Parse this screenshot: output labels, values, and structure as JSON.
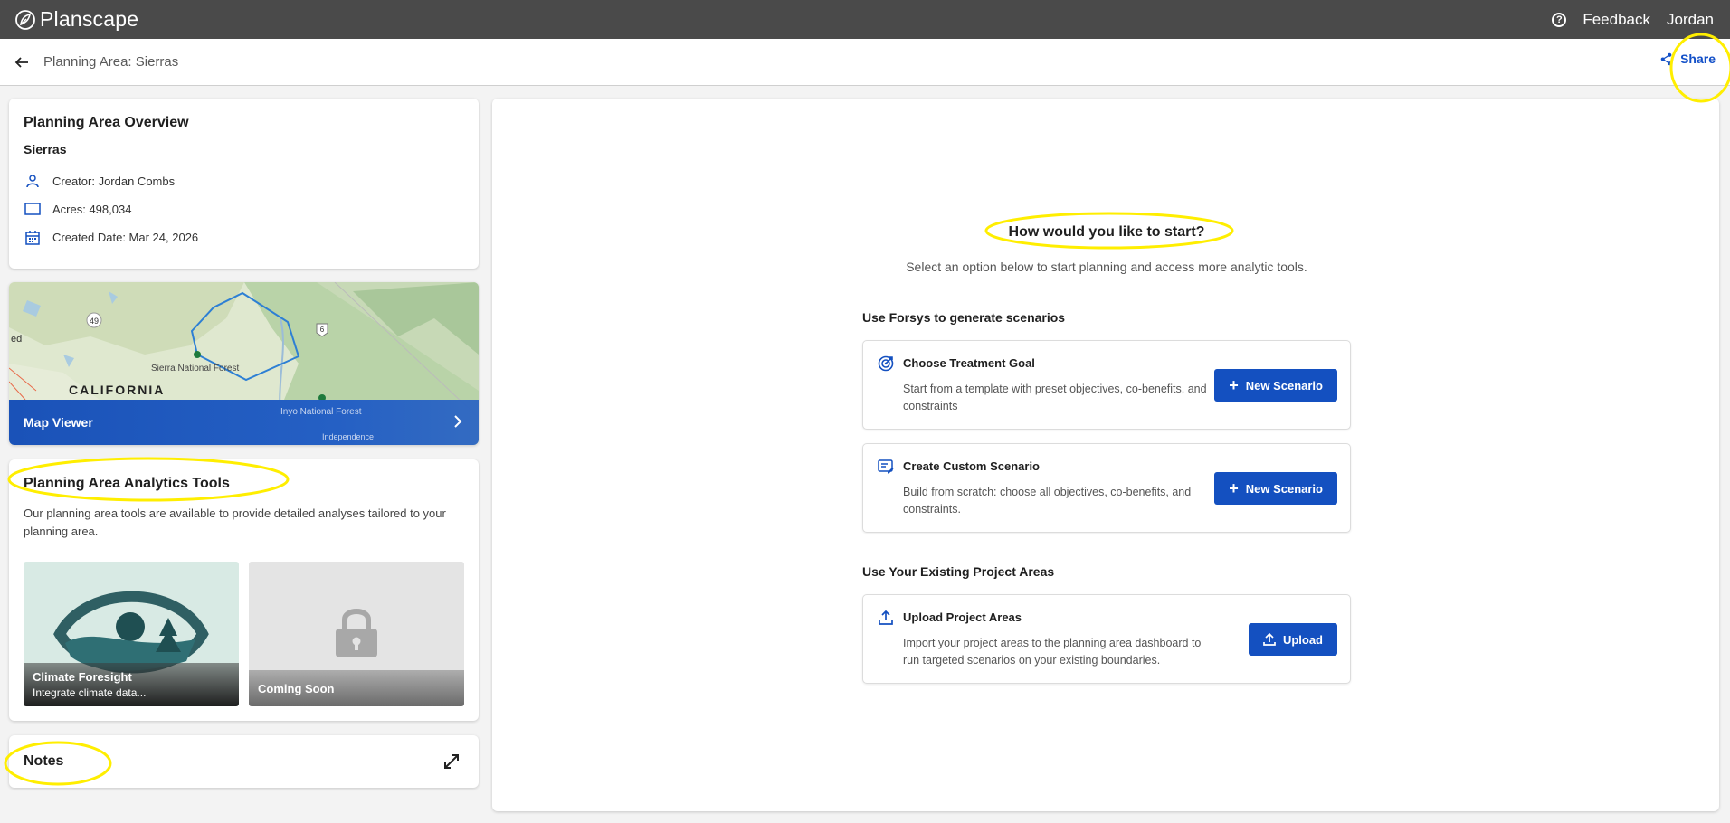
{
  "app": {
    "title": "Planscape"
  },
  "topbar": {
    "feedback": "Feedback",
    "user": "Jordan"
  },
  "subbar": {
    "breadcrumb": "Planning Area: Sierras",
    "share": "Share"
  },
  "overview": {
    "heading": "Planning Area Overview",
    "area_name": "Sierras",
    "creator": "Creator: Jordan Combs",
    "acres": "Acres: 498,034",
    "created": "Created Date: Mar 24, 2026"
  },
  "map": {
    "label": "Map Viewer",
    "state_label": "CALIFORNIA",
    "forest_label": "Sierra National Forest",
    "forest2_label": "Inyo National Forest",
    "town_label": "Independence",
    "highway_label": "49",
    "highway2_label": "6",
    "edge_label": "ed"
  },
  "analytics": {
    "heading": "Planning Area Analytics Tools",
    "description": "Our planning area tools are available to provide detailed analyses tailored to your planning area.",
    "tiles": [
      {
        "title": "Climate Foresight",
        "subtitle": "Integrate climate data..."
      },
      {
        "title": "Coming Soon"
      }
    ]
  },
  "notes": {
    "heading": "Notes"
  },
  "main": {
    "title": "How would you like to start?",
    "subtitle": "Select an option below to start planning and access more analytic tools.",
    "section1": "Use Forsys to generate scenarios",
    "section2": "Use Your Existing Project Areas",
    "options": [
      {
        "title": "Choose Treatment Goal",
        "desc": "Start from a template with preset objectives, co-benefits, and constraints",
        "button": "New Scenario"
      },
      {
        "title": "Create Custom Scenario",
        "desc": "Build from scratch: choose all objectives, co-benefits, and constraints.",
        "button": "New Scenario"
      },
      {
        "title": "Upload Project Areas",
        "desc": "Import your project areas to the planning area dashboard to run targeted scenarios on your existing boundaries.",
        "button": "Upload"
      }
    ]
  },
  "colors": {
    "primary": "#1450c0",
    "topbar": "#4a4a4a",
    "highlight": "#ffee00"
  }
}
